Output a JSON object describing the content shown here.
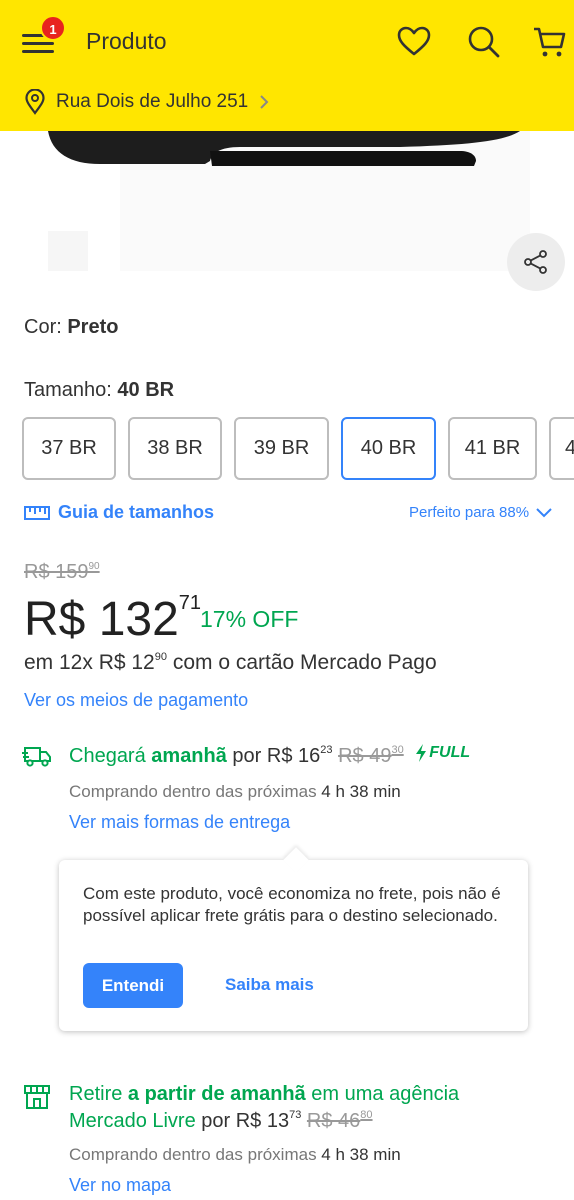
{
  "header": {
    "title": "Produto",
    "notification_count": "1",
    "address": "Rua Dois de Julho 251",
    "icons": [
      "menu-icon",
      "heart-icon",
      "search-icon",
      "cart-icon",
      "location-pin-icon",
      "chevron-right-icon"
    ],
    "background_color": "#ffe600"
  },
  "product": {
    "color_label": "Cor: ",
    "color_value": "Preto",
    "size_label": "Tamanho: ",
    "size_value": "40 BR",
    "sizes": [
      "37 BR",
      "38 BR",
      "39 BR",
      "40 BR",
      "41 BR",
      "4"
    ],
    "selected_size": "40 BR",
    "size_guide": "Guia de tamanhos",
    "fit": "Perfeito para 88%"
  },
  "price": {
    "old_main": "R$ 159",
    "old_cents": "90",
    "main": "R$ 132",
    "cents": "71",
    "discount": "17% OFF",
    "installments_pre": "em 12x R$ 12",
    "installments_cents": "90",
    "installments_post": " com o cartão Mercado Pago",
    "payment_link": "Ver os meios de pagamento"
  },
  "shipping": {
    "arrives": "Chegará ",
    "arrives_when": "amanhã",
    "price_pre": " por R$ 16",
    "price_cents": "23",
    "old_price": "R$ 49",
    "old_cents": "30",
    "full_label": "FULL",
    "condition": "Comprando dentro das próximas ",
    "time_left": "4 h 38 min",
    "more_link": "Ver mais formas de entrega"
  },
  "tooltip": {
    "text": "Com este produto, você economiza no frete, pois não é possível aplicar frete grátis para o destino selecionado.",
    "primary_button": "Entendi",
    "secondary_link": "Saiba mais"
  },
  "pickup": {
    "retire": "Retire ",
    "when": "a partir de amanhã",
    "where": " em uma agência",
    "agency": "Mercado Livre",
    "price_pre": " por R$ 13",
    "price_cents": "73",
    "old_price": "R$ 46",
    "old_cents": "80",
    "condition": "Comprando dentro das próximas ",
    "time_left": "4 h 38 min",
    "map_link": "Ver no mapa"
  },
  "colors": {
    "accent_blue": "#3483fa",
    "green": "#00a650",
    "badge_red": "#e8231e"
  }
}
